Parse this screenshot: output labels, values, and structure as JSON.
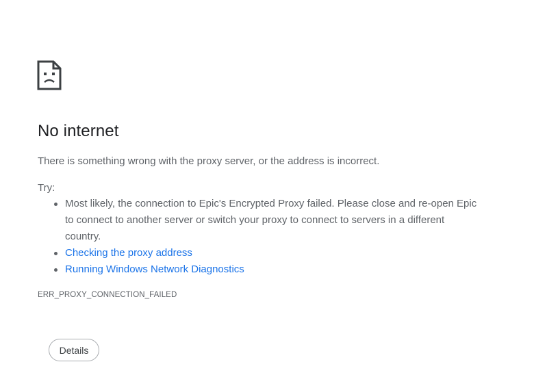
{
  "icon": "sad-page-icon",
  "title": "No internet",
  "summary": "There is something wrong with the proxy server, or the address is incorrect.",
  "try_label": "Try:",
  "suggestions": [
    {
      "text": "Most likely, the connection to Epic's Encrypted Proxy failed. Please close and re-open Epic to connect to another server or switch your proxy to connect to servers in a different country.",
      "link": false
    },
    {
      "text": "Checking the proxy address",
      "link": true
    },
    {
      "text": "Running Windows Network Diagnostics",
      "link": true
    }
  ],
  "error_code": "ERR_PROXY_CONNECTION_FAILED",
  "details_button": "Details",
  "colors": {
    "title": "#202124",
    "body_text": "#5f6368",
    "link": "#1a73e8",
    "button_border": "#a9acb0"
  }
}
